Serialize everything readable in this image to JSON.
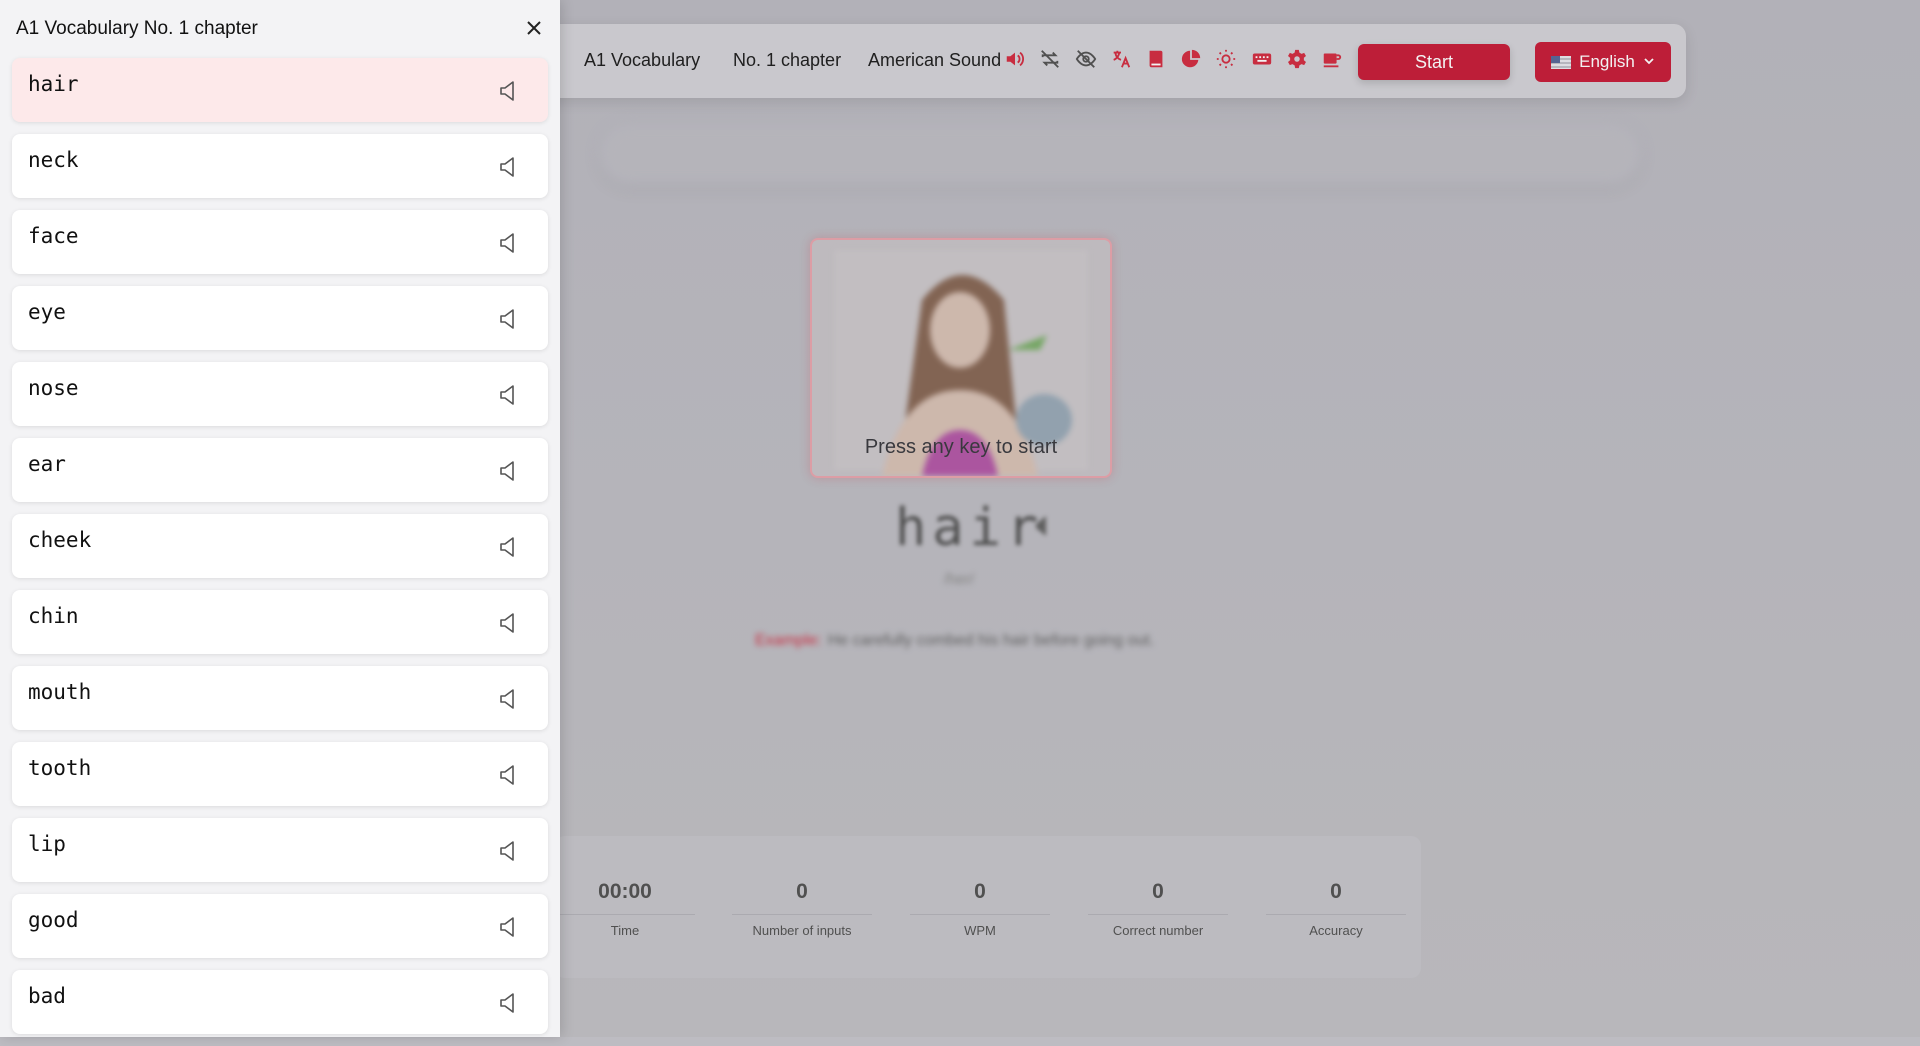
{
  "drawer": {
    "title": "A1 Vocabulary No. 1 chapter",
    "close_icon": "close-icon",
    "active_index": 0,
    "words": [
      {
        "word": "hair"
      },
      {
        "word": "neck"
      },
      {
        "word": "face"
      },
      {
        "word": "eye"
      },
      {
        "word": "nose"
      },
      {
        "word": "ear"
      },
      {
        "word": "cheek"
      },
      {
        "word": "chin"
      },
      {
        "word": "mouth"
      },
      {
        "word": "tooth"
      },
      {
        "word": "lip"
      },
      {
        "word": "good"
      },
      {
        "word": "bad"
      }
    ]
  },
  "header": {
    "dictionary": "A1 Vocabulary",
    "chapter": "No. 1 chapter",
    "sound": "American Sound",
    "icons": [
      "speaker-icon",
      "loop-off-icon",
      "eye-off-icon",
      "translate-icon",
      "book-icon",
      "pie-chart-icon",
      "sun-icon",
      "keyboard-icon",
      "gear-icon",
      "coffee-icon"
    ],
    "start_label": "Start",
    "language_label": "English"
  },
  "main": {
    "press_key": "Press any key to start",
    "word": "hair",
    "phonetic": "/her/",
    "example_label": "Example:",
    "example_text": "He carefully combed his hair before going out."
  },
  "stats": [
    {
      "value": "00:00",
      "label": "Time"
    },
    {
      "value": "0",
      "label": "Number of inputs"
    },
    {
      "value": "0",
      "label": "WPM"
    },
    {
      "value": "0",
      "label": "Correct number"
    },
    {
      "value": "0",
      "label": "Accuracy"
    }
  ],
  "colors": {
    "accent": "#c8203b",
    "active_row": "#fde9ea"
  }
}
